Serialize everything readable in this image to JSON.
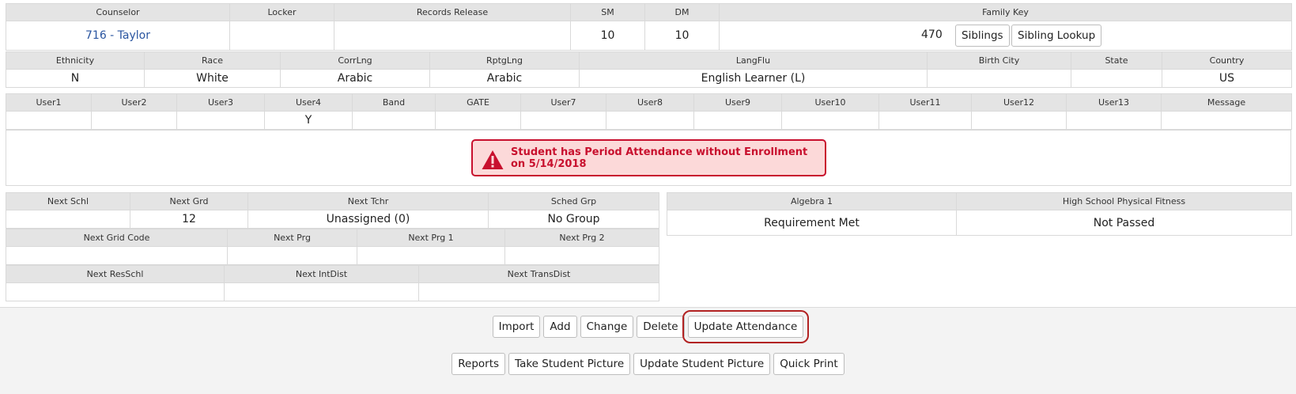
{
  "row1": {
    "headers": [
      "Counselor",
      "Locker",
      "Records Release",
      "SM",
      "DM",
      "Family Key"
    ],
    "counselor": "716 - Taylor",
    "locker": "",
    "records_release": "",
    "sm": "10",
    "dm": "10",
    "family_key": "470",
    "siblings_button": "Siblings",
    "sibling_lookup_button": "Sibling Lookup"
  },
  "row2": {
    "headers": [
      "Ethnicity",
      "Race",
      "CorrLng",
      "RptgLng",
      "LangFlu",
      "Birth City",
      "State",
      "Country"
    ],
    "values": [
      "N",
      "White",
      "Arabic",
      "Arabic",
      "English Learner (L)",
      "",
      "",
      "US"
    ]
  },
  "row3": {
    "headers": [
      "User1",
      "User2",
      "User3",
      "User4",
      "Band",
      "GATE",
      "User7",
      "User8",
      "User9",
      "User10",
      "User11",
      "User12",
      "User13",
      "Message"
    ],
    "values": [
      "",
      "",
      "",
      "Y",
      "",
      "",
      "",
      "",
      "",
      "",
      "",
      "",
      "",
      ""
    ]
  },
  "alert": {
    "message": "Student has Period Attendance without Enrollment on 5/14/2018",
    "icon": "warning-triangle-icon",
    "color": "#c8102e"
  },
  "next": {
    "headers1": [
      "Next Schl",
      "Next Grd",
      "Next Tchr",
      "Sched Grp"
    ],
    "values1": [
      "",
      "12",
      "Unassigned (0)",
      "No Group"
    ],
    "headers2": [
      "Next Grid Code",
      "Next Prg",
      "Next Prg 1",
      "Next Prg 2"
    ],
    "values2": [
      "",
      "",
      "",
      ""
    ],
    "headers3": [
      "Next ResSchl",
      "Next IntDist",
      "Next TransDist"
    ],
    "values3": [
      "",
      "",
      ""
    ]
  },
  "requirements": {
    "headers": [
      "Algebra 1",
      "High School Physical Fitness"
    ],
    "values": [
      "Requirement Met",
      "Not Passed"
    ]
  },
  "footer": {
    "row1_buttons": [
      "Import",
      "Add",
      "Change",
      "Delete",
      "Update Attendance"
    ],
    "row2_buttons": [
      "Reports",
      "Take Student Picture",
      "Update Student Picture",
      "Quick Print"
    ]
  }
}
